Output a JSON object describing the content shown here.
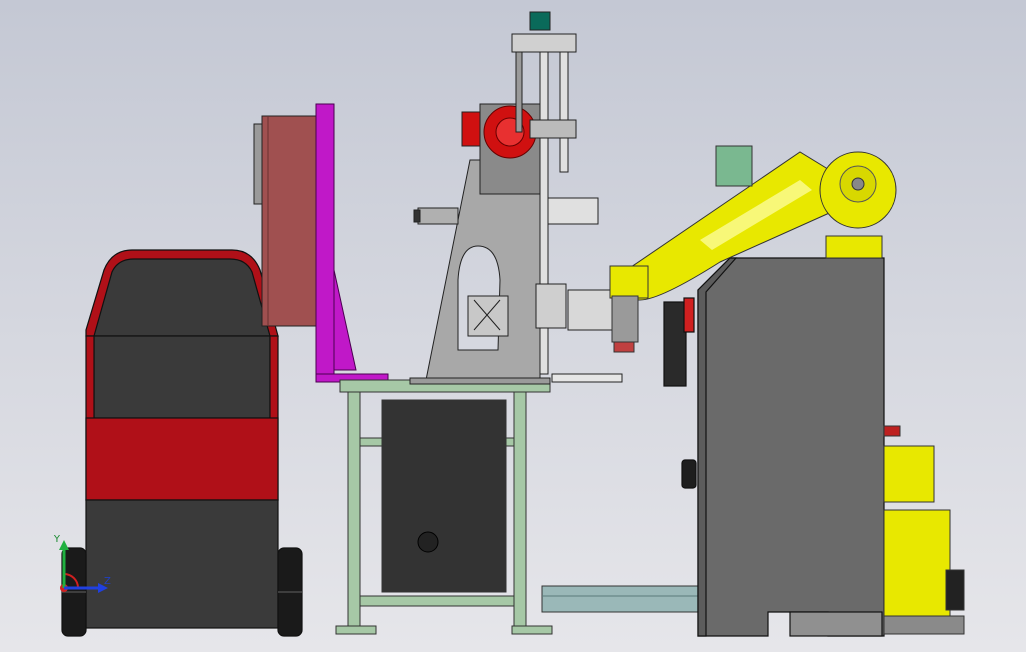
{
  "viewport": {
    "background_top": "#c4c8d4",
    "background_bottom": "#e6e6ea"
  },
  "triad": {
    "y_label": "Y",
    "z_label": "Z",
    "x_color": "#e02020",
    "y_color": "#20b040",
    "z_color": "#2040e0"
  },
  "colors": {
    "cart_red": "#b01018",
    "cart_dark": "#3a3a3a",
    "panel_brown": "#a05050",
    "magenta": "#c018c8",
    "bench_green": "#a6c8a6",
    "press_gray": "#a8a8a8",
    "motor_red": "#d01010",
    "robot_yellow": "#e8e800",
    "controller_gray": "#6a6a6a"
  }
}
